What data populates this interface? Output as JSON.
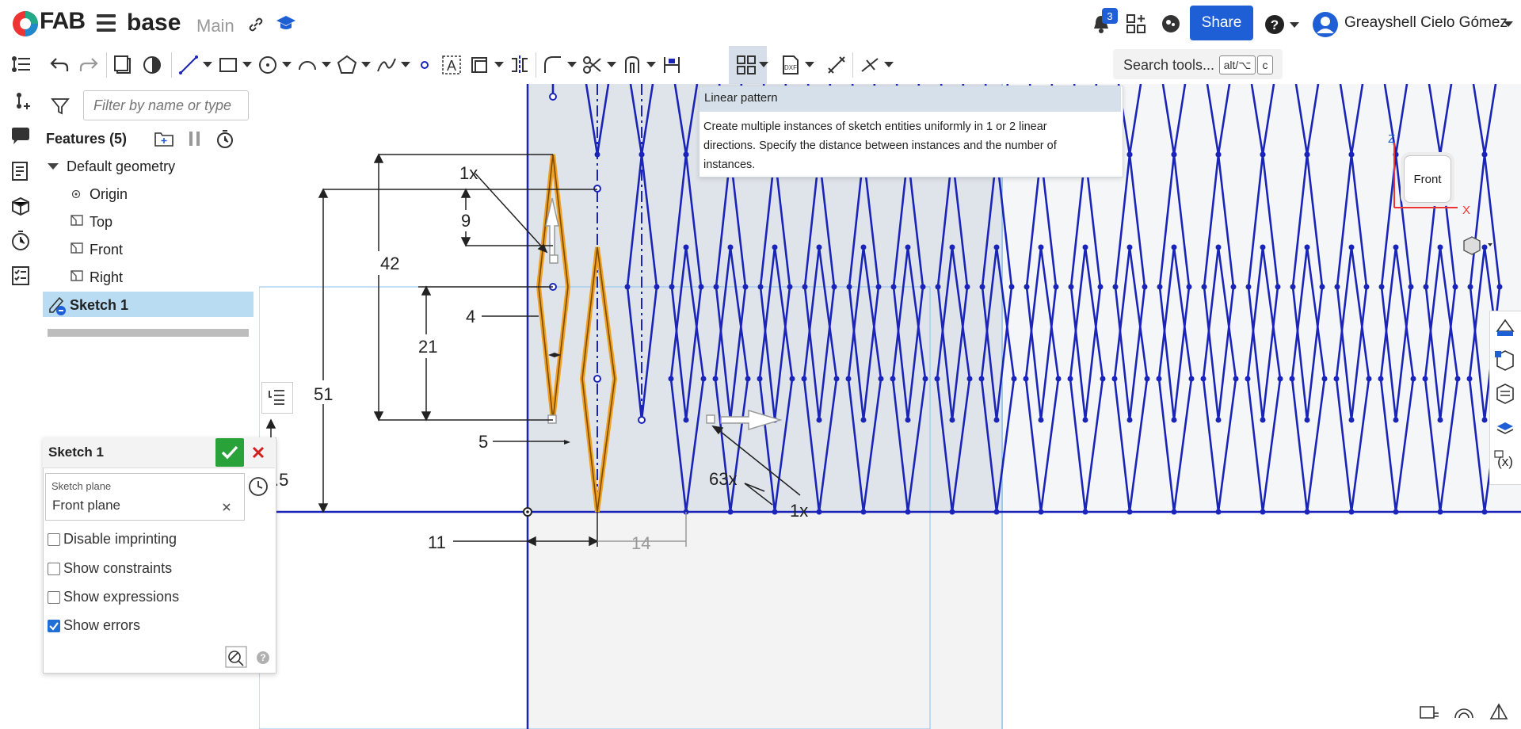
{
  "header": {
    "logo_text": "FAB",
    "document_title": "base",
    "branch": "Main",
    "notification_count": "3",
    "share_label": "Share",
    "user_name": "Greayshell Cielo Gómez"
  },
  "toolbar": {
    "search_label": "Search tools...",
    "shortcut_keys": [
      "alt/⌥",
      "c"
    ]
  },
  "features": {
    "filter_placeholder": "Filter by name or type",
    "header": "Features (5)",
    "default_geometry": "Default geometry",
    "items": [
      "Origin",
      "Top",
      "Front",
      "Right"
    ],
    "sketch": "Sketch 1"
  },
  "sketch_dialog": {
    "title": "Sketch 1",
    "plane_label": "Sketch plane",
    "plane_value": "Front plane",
    "options": [
      {
        "label": "Disable imprinting",
        "checked": false
      },
      {
        "label": "Show constraints",
        "checked": false
      },
      {
        "label": "Show expressions",
        "checked": false
      },
      {
        "label": "Show errors",
        "checked": true
      }
    ],
    "help": "?"
  },
  "tooltip": {
    "title": "Linear pattern",
    "body": "Create multiple instances of sketch entities uniformly in 1 or 2 linear directions. Specify the distance between instances and the number of instances."
  },
  "canvas": {
    "dimensions": {
      "d42": "42",
      "d51": "51",
      "d21": "21",
      "d9": "9",
      "d4": "4",
      "d5": "5",
      "d11": "11",
      "d14": "14",
      "d15": ".5",
      "count_1x_top": "1x",
      "count_63x": "63x",
      "count_1x_bottom": "1x"
    },
    "view_cube_label": "Front",
    "axis_x": "X",
    "axis_z": "Z"
  },
  "colors": {
    "accent": "#1f5fd6",
    "sketch_blue": "#1a25b8",
    "highlight_orange": "#f0a020",
    "ok_green": "#2aa23a",
    "cancel_red": "#d02020"
  }
}
